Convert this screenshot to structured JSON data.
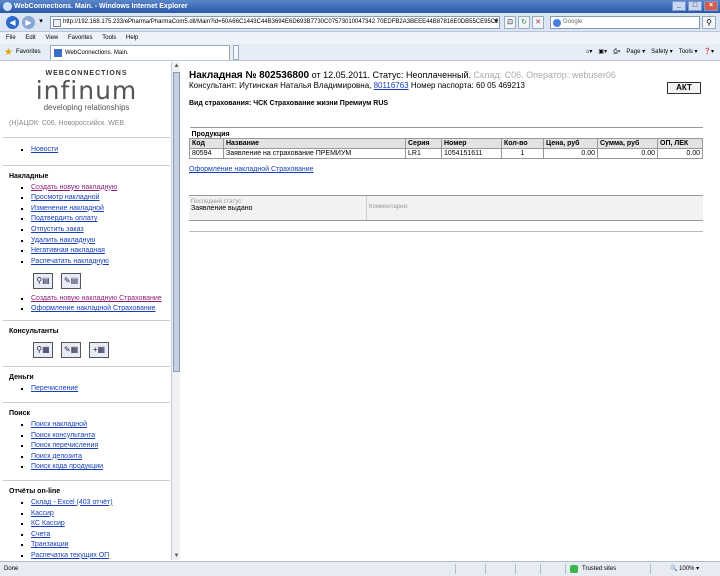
{
  "browser": {
    "title": "WebConnections. Main. - Windows Internet Explorer",
    "url": "http://192.168.175.233/ePharma/PharmaCom5.dll/Main?id=50A66C1443C44B3694E6D693B7730C07573010047342 70EDFB2A3BEEE44B87816E0DB55CE95C2",
    "search_placeholder": "Google",
    "menu": [
      "File",
      "Edit",
      "View",
      "Favorites",
      "Tools",
      "Help"
    ],
    "favorites_label": "Favorites",
    "tab_label": "WebConnections. Main.",
    "commands": [
      "Page ▾",
      "Safety ▾",
      "Tools ▾",
      "❓▾"
    ],
    "status_text": "Done",
    "trusted": "Trusted sites",
    "zoom": "100%"
  },
  "sidebar": {
    "brand_top": "WEBCONNECTIONS",
    "brand_logo": "infinum",
    "brand_tag": "developing relationships",
    "env": "(Н)АЦОК: С06. Новороссийск. WEB.",
    "news": "Новости",
    "sections": {
      "invoices": {
        "title": "Накладные",
        "items": [
          "Создать новую накладную",
          "Просмотр накладной",
          "Изменение накладной",
          "Подтвердить оплату",
          "Отпустить заказ",
          "Удалить накладную",
          "Негативная накладная",
          "Распечатать накладную"
        ],
        "extra": [
          "Создать новую накладную Страхование",
          "Оформление накладной Страхование"
        ]
      },
      "consultants": {
        "title": "Консультанты"
      },
      "money": {
        "title": "Деньги",
        "items": [
          "Перечисление"
        ]
      },
      "search": {
        "title": "Поиск",
        "items": [
          "Поиск накладной",
          "Поиск консультанта",
          "Поиск перечисления",
          "Поиск депозита",
          "Поиск кода продукции"
        ]
      },
      "reports": {
        "title": "Отчёты on-line",
        "items": [
          "Склад - Excel (403 отчёт)",
          "Кассир",
          "КС Кассир",
          "Счета",
          "Транзакции",
          "Распечатка текущих ОП"
        ]
      }
    }
  },
  "main": {
    "invoice_label": "Накладная №",
    "invoice_number": "802536800",
    "date_text": "от 12.05.2011.",
    "status_label": "Статус:",
    "status_value": "Неоплаченный.",
    "warehouse_text": "Склад: С06. Оператор: webuser06",
    "consultant_label": "Консультант:",
    "consultant_name": "Иутинская Наталья Владимировна,",
    "consultant_id": "80116763",
    "passport_text": "Номер паспорта: 60 05 469213",
    "akt_label": "АКТ",
    "insurance_label": "Вид страхования:",
    "insurance_value": "ЧСК Страхование жизни Премиум RUS",
    "products_caption": "Продукция",
    "columns": [
      "Код",
      "Название",
      "Серия",
      "Номер",
      "Кол-во",
      "Цена, руб",
      "Сумма, руб",
      "ОП, ЛЕК"
    ],
    "rows": [
      [
        "80594",
        "Заявление на страхование ПРЕМИУМ",
        "LR1",
        "1054151611",
        "1",
        "0.00",
        "0.00",
        "0.00"
      ]
    ],
    "action_link": "Оформление накладной Страхование",
    "last_status_label": "Последний статус:",
    "last_status_value": "Заявление выдано",
    "comments_label": "Комментарии:"
  }
}
